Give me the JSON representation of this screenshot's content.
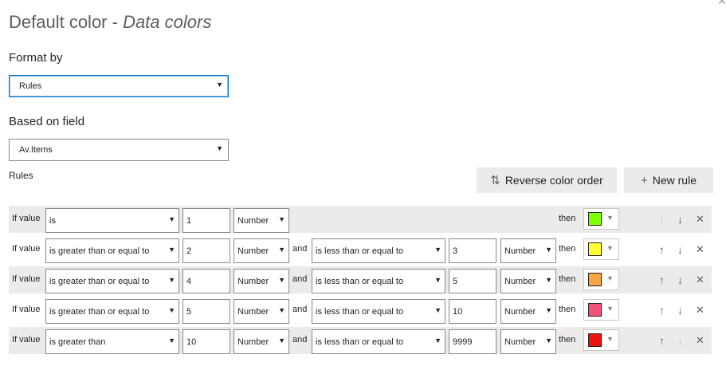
{
  "dialog": {
    "title": "Default color - ",
    "title_italic": "Data colors",
    "close_glyph": "✕"
  },
  "format_by": {
    "label": "Format by",
    "value": "Rules"
  },
  "based_on": {
    "label": "Based on field",
    "value": "Av.Items"
  },
  "rules_label": "Rules",
  "buttons": {
    "reverse_label": "Reverse color order",
    "new_rule_label": "New rule"
  },
  "icons": {
    "reverse": "reverse-sort-icon",
    "plus": "plus-icon",
    "up": "arrow-up-icon",
    "down": "arrow-down-icon",
    "delete": "close-icon"
  },
  "rules": [
    {
      "if_label": "If value",
      "op1": "is",
      "val1": "1",
      "type1": "Number",
      "and_label": "",
      "op2": "",
      "val2": "",
      "type2": "",
      "then_label": "then",
      "color": "#80ff00"
    },
    {
      "if_label": "If value",
      "op1": "is greater than or equal to",
      "val1": "2",
      "type1": "Number",
      "and_label": "and",
      "op2": "is less than or equal to",
      "val2": "3",
      "type2": "Number",
      "then_label": "then",
      "color": "#ffff33"
    },
    {
      "if_label": "If value",
      "op1": "is greater than or equal to",
      "val1": "4",
      "type1": "Number",
      "and_label": "and",
      "op2": "is less than or equal to",
      "val2": "5",
      "type2": "Number",
      "then_label": "then",
      "color": "#f4a742"
    },
    {
      "if_label": "If value",
      "op1": "is greater than or equal to",
      "val1": "5",
      "type1": "Number",
      "and_label": "and",
      "op2": "is less than or equal to",
      "val2": "10",
      "type2": "Number",
      "then_label": "then",
      "color": "#f0527a"
    },
    {
      "if_label": "If value",
      "op1": "is greater than",
      "val1": "10",
      "type1": "Number",
      "and_label": "and",
      "op2": "is less than or equal to",
      "val2": "9999",
      "type2": "Number",
      "then_label": "then",
      "color": "#ee1111"
    }
  ]
}
